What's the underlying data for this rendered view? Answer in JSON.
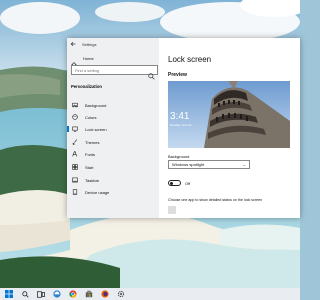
{
  "window": {
    "app_title": "Settings",
    "back_icon": "back-arrow-icon"
  },
  "nav": {
    "home_label": "Home",
    "search_placeholder": "Find a setting",
    "section_title": "Personalization",
    "items": [
      {
        "label": "Background",
        "icon": "image-icon"
      },
      {
        "label": "Colors",
        "icon": "palette-icon"
      },
      {
        "label": "Lock screen",
        "icon": "monitor-icon",
        "active": true
      },
      {
        "label": "Themes",
        "icon": "brush-icon"
      },
      {
        "label": "Fonts",
        "icon": "font-icon"
      },
      {
        "label": "Start",
        "icon": "start-icon"
      },
      {
        "label": "Taskbar",
        "icon": "taskbar-icon"
      },
      {
        "label": "Device usage",
        "icon": "device-icon"
      }
    ]
  },
  "content": {
    "page_title": "Lock screen",
    "preview_title": "Preview",
    "clock": "3:41",
    "date": "Monday, June 10",
    "background_label": "Background",
    "background_value": "Windows spotlight",
    "toggle_state": "Off",
    "choose_text": "Choose one app to show detailed status on the lock screen"
  },
  "taskbar": {
    "items": [
      "start-icon",
      "search-icon",
      "taskview-icon",
      "edge-icon",
      "chrome-icon",
      "store-icon",
      "firefox-icon",
      "settings-icon"
    ]
  },
  "colors": {
    "accent": "#0078d7",
    "nav_bg": "#eef0f2",
    "taskbar_bg": "#e9edf1"
  }
}
